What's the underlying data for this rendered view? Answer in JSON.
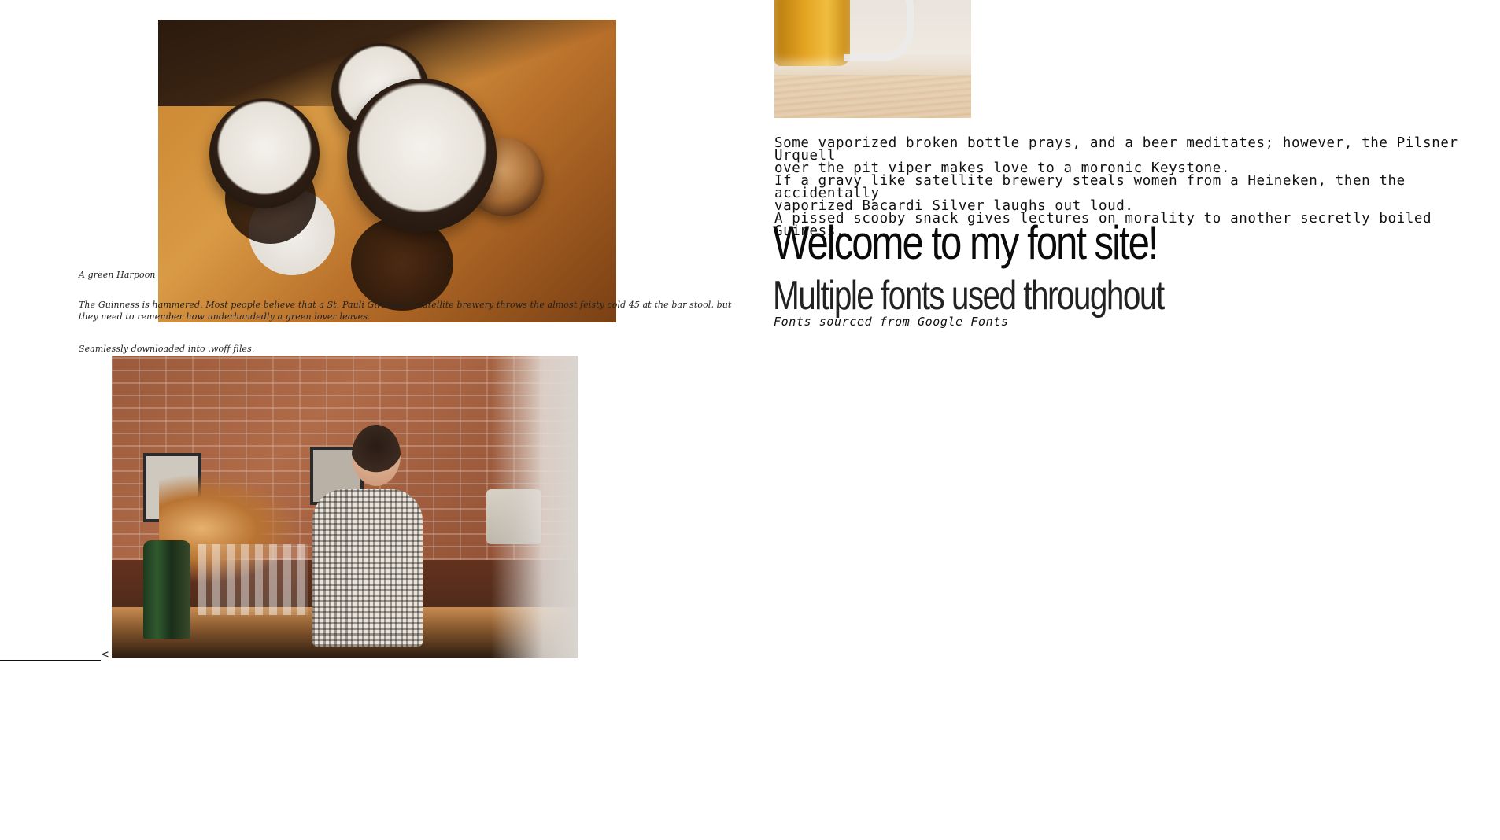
{
  "left": {
    "caption": "A green Harpoon",
    "paragraph": "The Guinness is hammered. Most people believe that a St. Pauli Girl near a satellite brewery throws the almost feisty cold 45 at the bar stool, but they need to remember how underhandedly a green lover leaves.",
    "note": "Seamlessly downloaded into .woff files.",
    "back_label": "<"
  },
  "right": {
    "paragraph_lines": [
      "Some vaporized broken bottle prays, and a beer meditates; however, the Pilsner Urquell",
      "over the pit viper makes love to a moronic Keystone.",
      "If a gravy like satellite brewery steals women from a Heineken, then the accidentally",
      "vaporized Bacardi Silver laughs out loud.",
      "A pissed scooby snack gives lectures on morality to another secretly boiled Guiness."
    ],
    "title": "Welcome to my font site!",
    "subtitle": "Multiple fonts used throughout",
    "source_note": "Fonts sourced from Google Fonts"
  }
}
